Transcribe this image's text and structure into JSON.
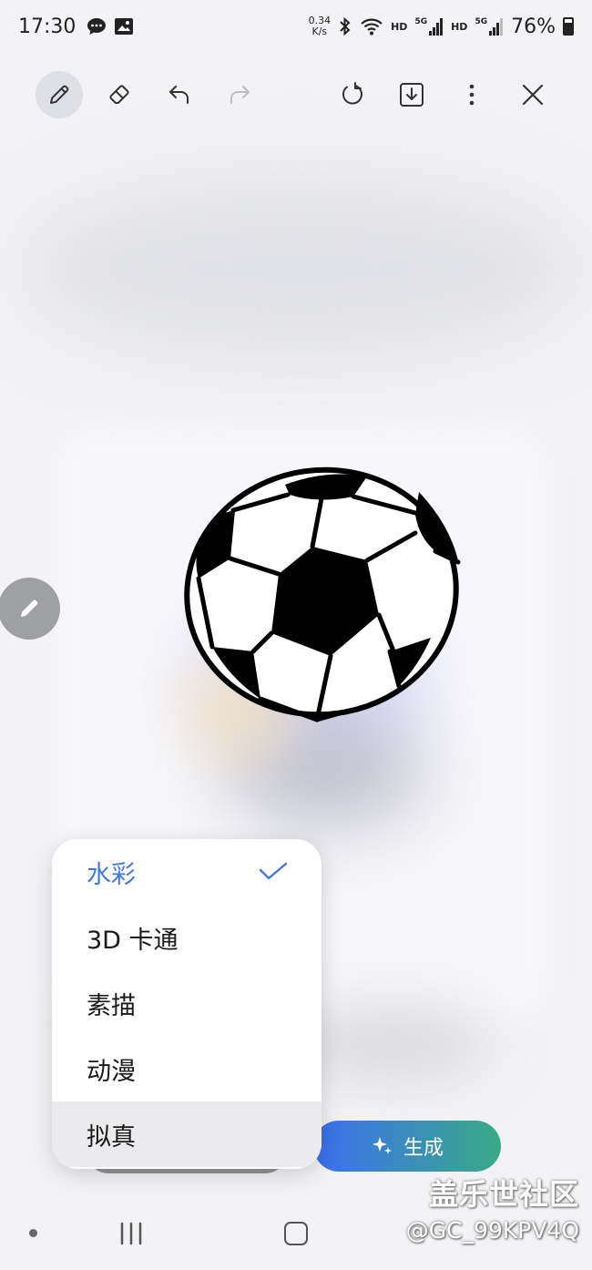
{
  "status_bar": {
    "time": "17:30",
    "speed_value": "0.34",
    "speed_unit": "K/s",
    "hd1": "HD",
    "hd2": "HD",
    "net1": "5G",
    "net2": "5G",
    "battery": "76%"
  },
  "toolbar": {
    "icons": [
      "pen-icon",
      "eraser-icon",
      "undo-icon",
      "redo-icon",
      "refresh-icon",
      "download-icon",
      "more-icon",
      "close-icon"
    ]
  },
  "style_menu": {
    "items": [
      {
        "label": "水彩",
        "selected": true
      },
      {
        "label": "3D 卡通",
        "selected": false
      },
      {
        "label": "素描",
        "selected": false
      },
      {
        "label": "动漫",
        "selected": false
      },
      {
        "label": "拟真",
        "selected": false
      }
    ]
  },
  "generate": {
    "label": "生成"
  },
  "watermark": {
    "title": "盖乐世社区",
    "id": "@GC_99KPV4Q"
  },
  "colors": {
    "accent": "#3f7ae0",
    "generate_start": "#3b6ff2",
    "generate_end": "#3aaa86"
  }
}
